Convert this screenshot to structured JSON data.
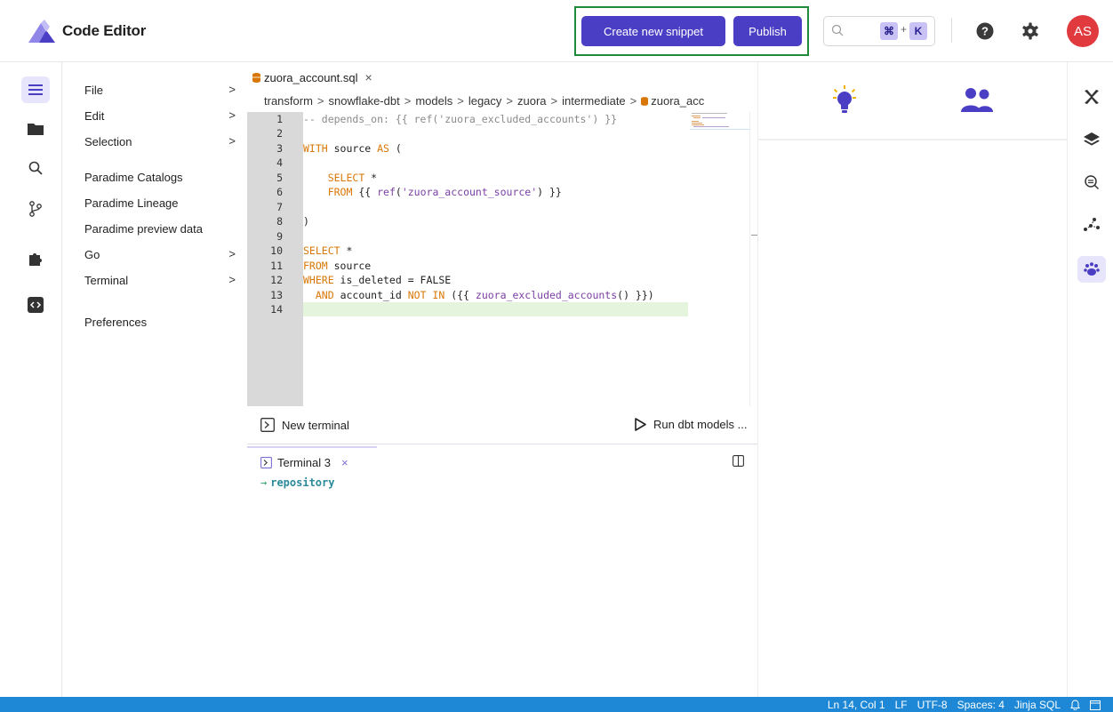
{
  "header": {
    "app_title": "Code Editor",
    "create_snippet_label": "Create new snippet",
    "publish_label": "Publish",
    "shortcut_cmd": "⌘",
    "shortcut_plus": "+",
    "shortcut_key": "K",
    "avatar_initials": "AS"
  },
  "menu": {
    "items": [
      {
        "label": "File",
        "chevron": ">"
      },
      {
        "label": "Edit",
        "chevron": ">"
      },
      {
        "label": "Selection",
        "chevron": ">"
      },
      {
        "label": "Paradime Catalogs"
      },
      {
        "label": "Paradime Lineage"
      },
      {
        "label": "Paradime preview data"
      },
      {
        "label": "Go",
        "chevron": ">"
      },
      {
        "label": "Terminal",
        "chevron": ">"
      },
      {
        "label": "Preferences"
      }
    ]
  },
  "editor": {
    "tab_name": "zuora_account.sql",
    "tab_close": "×",
    "breadcrumb": [
      "transform",
      "snowflake-dbt",
      "models",
      "legacy",
      "zuora",
      "intermediate",
      "zuora_acc"
    ],
    "breadcrumb_sep": ">",
    "line_numbers": [
      "1",
      "2",
      "3",
      "4",
      "5",
      "6",
      "7",
      "8",
      "9",
      "10",
      "11",
      "12",
      "13",
      "14"
    ]
  },
  "terminal": {
    "new_terminal_label": "New terminal",
    "run_label": "Run dbt models ...",
    "tab_label": "Terminal 3",
    "tab_close": "×",
    "prompt_arrow": "→",
    "prompt_text": "repository"
  },
  "status": {
    "position": "Ln 14, Col 1",
    "eol": "LF",
    "encoding": "UTF-8",
    "indent": "Spaces: 4",
    "language": "Jinja SQL"
  },
  "colors": {
    "primary": "#4a3fc4",
    "highlight_border": "#1f8a3a",
    "avatar": "#e0393e",
    "status_bar": "#1e88d6",
    "keyword": "#d97706",
    "function": "#7b3fa5"
  }
}
